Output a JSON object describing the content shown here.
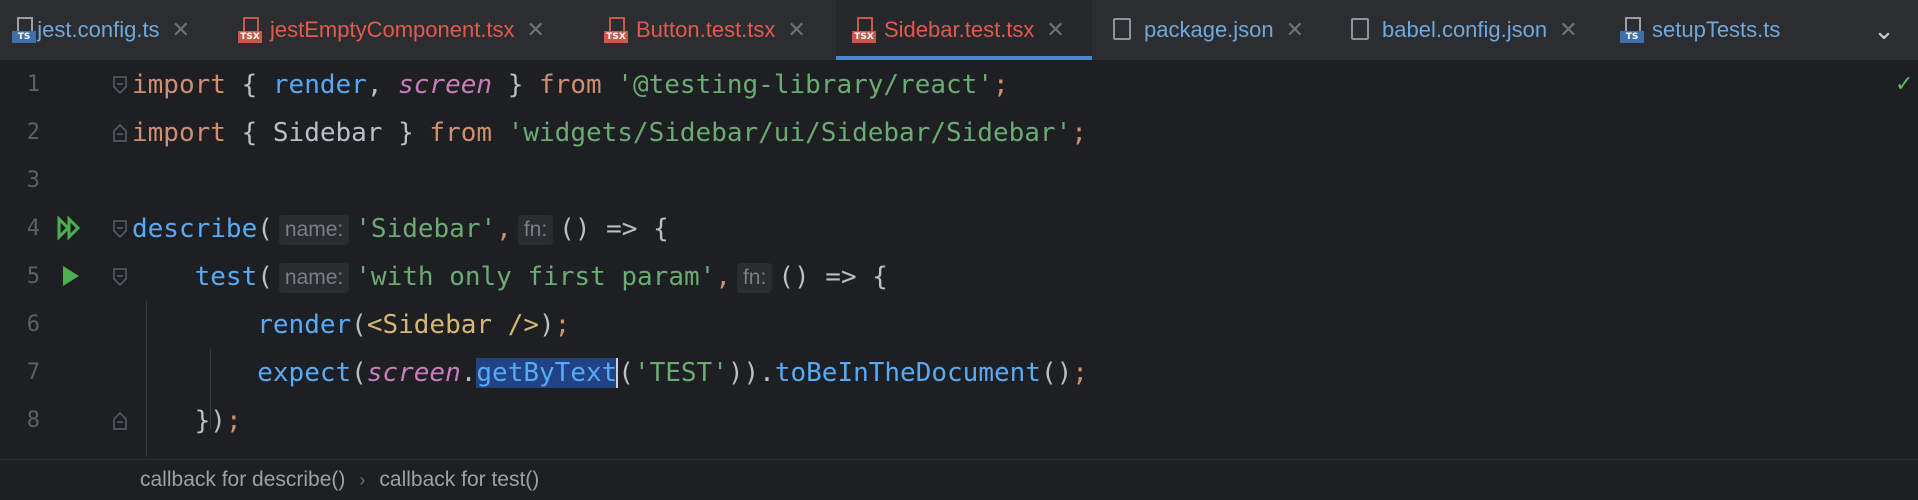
{
  "tabs": [
    {
      "label": "jest.config.ts",
      "icon": "ts-file-icon",
      "active": false,
      "error": false
    },
    {
      "label": "jestEmptyComponent.tsx",
      "icon": "tsx-file-icon",
      "active": false,
      "error": true
    },
    {
      "label": "Button.test.tsx",
      "icon": "tsx-file-icon",
      "active": false,
      "error": true
    },
    {
      "label": "Sidebar.test.tsx",
      "icon": "tsx-file-icon",
      "active": true,
      "error": true
    },
    {
      "label": "package.json",
      "icon": "json-file-icon",
      "active": false,
      "error": false
    },
    {
      "label": "babel.config.json",
      "icon": "json-file-icon",
      "active": false,
      "error": false
    },
    {
      "label": "setupTests.ts",
      "icon": "ts-file-icon",
      "active": false,
      "error": false
    }
  ],
  "close_glyph": "✕",
  "tab_icon_text": {
    "ts": "TS",
    "tsx": "TSX"
  },
  "editor": {
    "line_numbers": [
      "1",
      "2",
      "3",
      "4",
      "5",
      "6",
      "7",
      "8"
    ],
    "line1": {
      "kw1": "import",
      "p1": " { ",
      "fn": "render",
      "p2": ", ",
      "it": "screen",
      "p3": " } ",
      "kw2": "from",
      "sp": " ",
      "str": "'@testing-library/react'",
      "end": ";"
    },
    "line2": {
      "kw1": "import",
      "p1": " { Sidebar } ",
      "kw2": "from",
      "sp": " ",
      "str": "'widgets/Sidebar/ui/Sidebar/Sidebar'",
      "end": ";"
    },
    "line4": {
      "fn": "describe",
      "p1": "(",
      "hint1": "name:",
      "str": "'Sidebar'",
      "p2": ",",
      "hint2": "fn:",
      "rest": "() => {"
    },
    "line5": {
      "indent": "    ",
      "fn": "test",
      "p1": "(",
      "hint1": "name:",
      "str": "'with only first param'",
      "p2": ",",
      "hint2": "fn:",
      "rest": "() => {"
    },
    "line6": {
      "indent": "        ",
      "fn": "render",
      "p1": "(",
      "tag1": "<Sidebar />",
      "p2": ")",
      "end": ";"
    },
    "line7": {
      "indent": "        ",
      "fn": "expect",
      "p1": "(",
      "it": "screen",
      "dot": ".",
      "sel_a": "getByT",
      "sel_b": "ext",
      "p2": "(",
      "str": "'TEST'",
      "p3": ")).",
      "fn2": "toBeInTheDocument",
      "p4": "()",
      "end": ";"
    },
    "line8": {
      "indent": "    ",
      "p1": "})",
      "end": ";"
    }
  },
  "breadcrumb": {
    "item1": "callback for describe()",
    "separator": "›",
    "item2": "callback for test()"
  },
  "status_check": "✓",
  "colors": {
    "accent": "#4a88c7",
    "error_tab": "#e25a4d",
    "run_icon": "#4caf50"
  }
}
